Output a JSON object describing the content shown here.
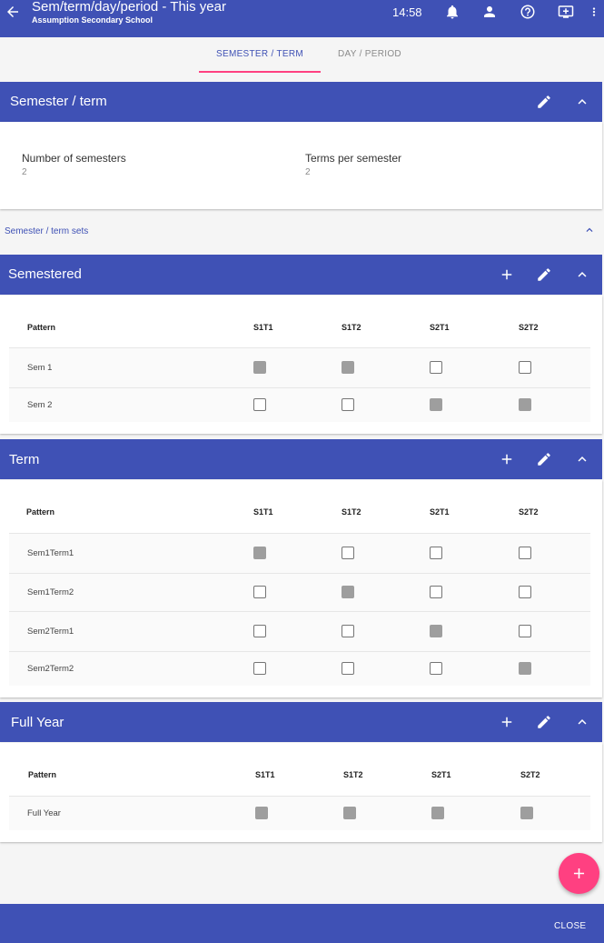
{
  "appbar": {
    "title": "Sem/term/day/period - This year",
    "subtitle": "Assumption Secondary School",
    "time": "14:58",
    "icons": [
      "arrow-back-icon",
      "bell-icon",
      "person-icon",
      "help-icon",
      "monitor-icon",
      "more-vert-icon"
    ]
  },
  "tabs": {
    "active": "SEMESTER / TERM",
    "inactive": "DAY / PERIOD"
  },
  "semester_card": {
    "title": "Semester / term",
    "fields": [
      {
        "label": "Number of semesters",
        "value": "2"
      },
      {
        "label": "Terms per semester",
        "value": "2"
      }
    ]
  },
  "sets_bar": {
    "label": "Semester / term sets"
  },
  "columns": [
    "S1T1",
    "S1T2",
    "S2T1",
    "S2T2"
  ],
  "pattern_header": "Pattern",
  "sections": [
    {
      "title": "Semestered",
      "rows": [
        {
          "label": "Sem 1",
          "checks": [
            true,
            true,
            false,
            false
          ]
        },
        {
          "label": "Sem 2",
          "checks": [
            false,
            false,
            true,
            true
          ]
        }
      ]
    },
    {
      "title": "Term",
      "rows": [
        {
          "label": "Sem1Term1",
          "checks": [
            true,
            false,
            false,
            false
          ]
        },
        {
          "label": "Sem1Term2",
          "checks": [
            false,
            true,
            false,
            false
          ]
        },
        {
          "label": "Sem2Term1",
          "checks": [
            false,
            false,
            true,
            false
          ]
        },
        {
          "label": "Sem2Term2",
          "checks": [
            false,
            false,
            false,
            true
          ]
        }
      ]
    },
    {
      "title": "Full Year",
      "rows": [
        {
          "label": "Full Year",
          "checks": [
            true,
            true,
            true,
            true
          ]
        }
      ]
    }
  ],
  "fab": {
    "icon": "plus-icon"
  },
  "bottombar": {
    "close_label": "CLOSE"
  },
  "colors": {
    "primary": "#3f51b5",
    "accent": "#ff4081"
  }
}
